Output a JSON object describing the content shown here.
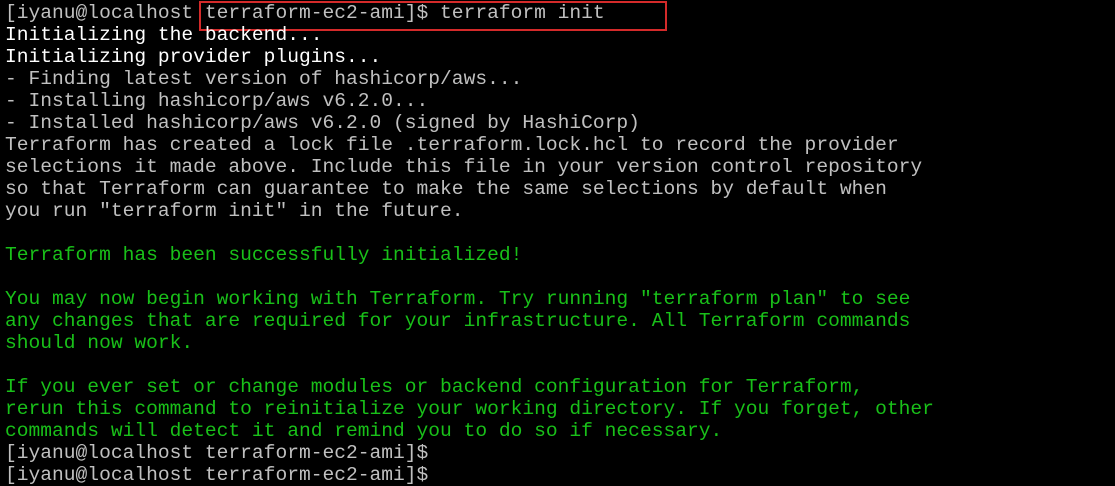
{
  "colors": {
    "background": "#000000",
    "text_default": "#c0c0c0",
    "text_bright": "#ffffff",
    "text_success": "#19c019",
    "highlight_box": "#d42a2a"
  },
  "terminal": {
    "lines": [
      "[iyanu@localhost terraform-ec2-ami]$ terraform init",
      "Initializing the backend...",
      "Initializing provider plugins...",
      "- Finding latest version of hashicorp/aws...",
      "- Installing hashicorp/aws v6.2.0...",
      "- Installed hashicorp/aws v6.2.0 (signed by HashiCorp)",
      "Terraform has created a lock file .terraform.lock.hcl to record the provider",
      "selections it made above. Include this file in your version control repository",
      "so that Terraform can guarantee to make the same selections by default when",
      "you run \"terraform init\" in the future.",
      "",
      "Terraform has been successfully initialized!",
      "",
      "You may now begin working with Terraform. Try running \"terraform plan\" to see",
      "any changes that are required for your infrastructure. All Terraform commands",
      "should now work.",
      "",
      "If you ever set or change modules or backend configuration for Terraform,",
      "rerun this command to reinitialize your working directory. If you forget, other",
      "commands will detect it and remind you to do so if necessary.",
      "[iyanu@localhost terraform-ec2-ami]$",
      "[iyanu@localhost terraform-ec2-ami]$"
    ]
  }
}
